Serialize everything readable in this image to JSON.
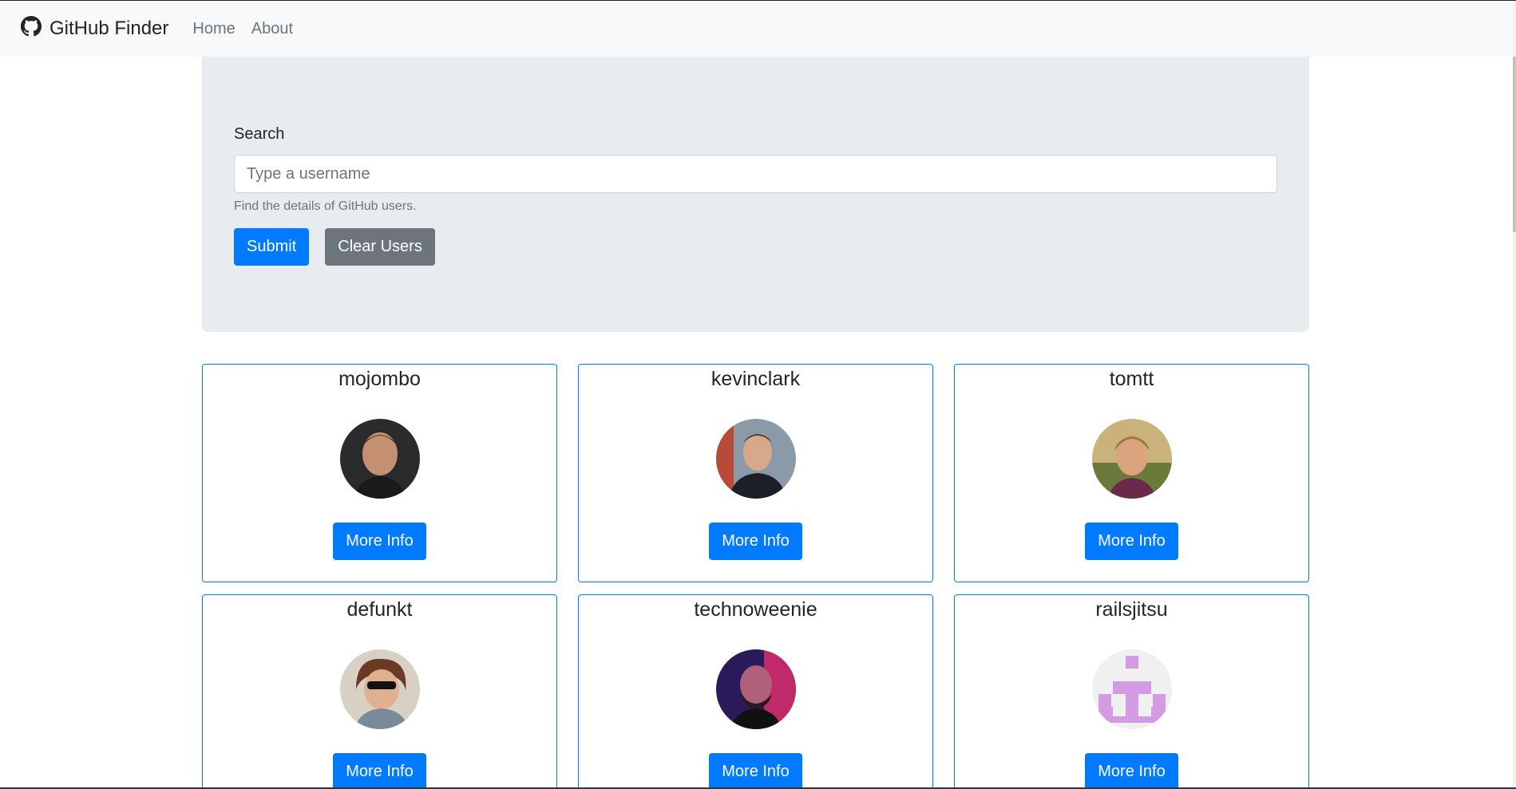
{
  "navbar": {
    "brand": "GitHub Finder",
    "brand_icon": "github-icon",
    "links": [
      "Home",
      "About"
    ]
  },
  "search": {
    "label": "Search",
    "placeholder": "Type a username",
    "value": "",
    "help": "Find the details of GitHub users.",
    "submit_label": "Submit",
    "clear_label": "Clear Users"
  },
  "users": [
    {
      "login": "mojombo",
      "button": "More Info"
    },
    {
      "login": "kevinclark",
      "button": "More Info"
    },
    {
      "login": "tomtt",
      "button": "More Info"
    },
    {
      "login": "defunkt",
      "button": "More Info"
    },
    {
      "login": "technoweenie",
      "button": "More Info"
    },
    {
      "login": "railsjitsu",
      "button": "More Info"
    }
  ],
  "colors": {
    "primary": "#007bff",
    "secondary": "#6c757d",
    "jumbotron": "#e9ecef",
    "navbar": "#f8f9fa"
  }
}
